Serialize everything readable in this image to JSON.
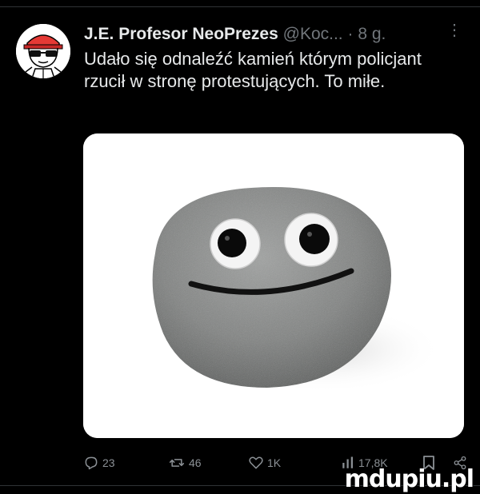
{
  "tweet": {
    "display_name": "J.E. Profesor NeoPrezes",
    "handle": "@Koc...",
    "separator": "·",
    "time": "8 g.",
    "more_label": "⋮",
    "text": "Udało się odnaleźć kamień którym policjant rzucił w stronę protestujących. To miłe."
  },
  "actions": {
    "replies": "23",
    "retweets": "46",
    "likes": "1K",
    "views": "17,8K"
  },
  "icons": {
    "reply": "reply-icon",
    "retweet": "retweet-icon",
    "like": "heart-icon",
    "views": "views-icon",
    "bookmark": "bookmark-icon",
    "share": "share-icon",
    "more": "more-icon"
  },
  "colors": {
    "background": "#000000",
    "text": "#e7e9ea",
    "muted": "#71767b"
  },
  "watermark": "mdupiu.pl"
}
